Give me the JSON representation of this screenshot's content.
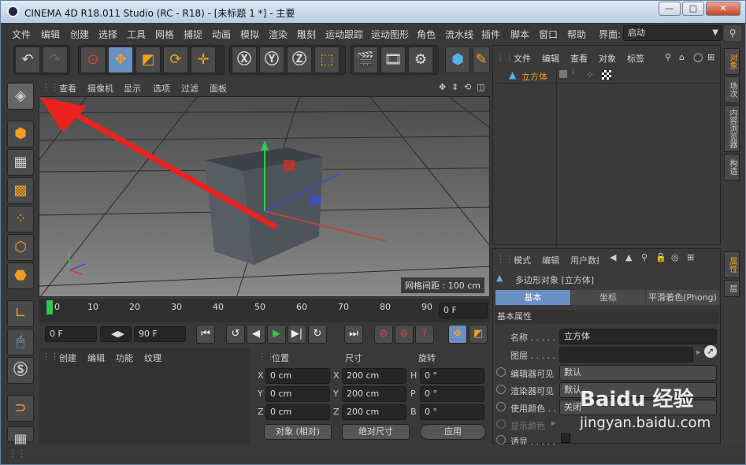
{
  "window": {
    "title": "CINEMA 4D R18.011 Studio (RC - R18) - [未标题 1 *] - 主要",
    "minimize": "—",
    "maximize": "□",
    "close": "✕"
  },
  "menu": [
    "文件",
    "编辑",
    "创建",
    "选择",
    "工具",
    "网格",
    "捕捉",
    "动画",
    "模拟",
    "渲染",
    "雕刻",
    "运动跟踪",
    "运动图形",
    "角色",
    "流水线",
    "插件",
    "脚本",
    "窗口",
    "帮助"
  ],
  "layout": {
    "label": "界面:",
    "value": "启动"
  },
  "viewport": {
    "menus": [
      "查看",
      "摄像机",
      "显示",
      "选项",
      "过滤",
      "面板"
    ],
    "status": "网格间距 : 100 cm"
  },
  "timeline": {
    "ticks": [
      "0",
      "10",
      "20",
      "30",
      "40",
      "50",
      "60",
      "70",
      "80",
      "90"
    ],
    "frame_field": "0 F"
  },
  "playback": {
    "start": "0 F",
    "end": "90 F"
  },
  "material": {
    "menus": [
      "创建",
      "编辑",
      "功能",
      "纹理"
    ]
  },
  "coords": {
    "headers": [
      "位置",
      "尺寸",
      "旋转"
    ],
    "rows": [
      {
        "a": "X",
        "pos": "0 cm",
        "b": "X",
        "size": "200 cm",
        "c": "H",
        "rot": "0 °"
      },
      {
        "a": "Y",
        "pos": "0 cm",
        "b": "Y",
        "size": "200 cm",
        "c": "P",
        "rot": "0 °"
      },
      {
        "a": "Z",
        "pos": "0 cm",
        "b": "Z",
        "size": "200 cm",
        "c": "B",
        "rot": "0 °"
      }
    ],
    "mode": "对象 (相对)",
    "size_mode": "绝对尺寸",
    "apply": "应用"
  },
  "objects": {
    "menus": [
      "文件",
      "编辑",
      "查看",
      "对象",
      "标签"
    ],
    "item": "立方体"
  },
  "attributes": {
    "menus": [
      "模式",
      "编辑",
      "用户数据"
    ],
    "title": "多边形对象 [立方体]",
    "tabs": [
      "基本",
      "坐标",
      "平滑着色(Phong)"
    ],
    "section": "基本属性",
    "fields": [
      {
        "label": "名称 . . . . .",
        "value": "立方体"
      },
      {
        "label": "图层 . . . . .",
        "value": ""
      },
      {
        "label": "编辑器可见",
        "value": "默认"
      },
      {
        "label": "渲染器可见",
        "value": "默认"
      },
      {
        "label": "使用颜色 . .",
        "value": "关闭"
      },
      {
        "label": "显示颜色",
        "value": ""
      },
      {
        "label": "透显 . . . . .",
        "value": ""
      }
    ]
  },
  "right_tabs": [
    "对象",
    "场次",
    "内容浏览器",
    "构造",
    "属性",
    "层"
  ],
  "watermark": {
    "main": "Baidu 经验",
    "sub": "jingyan.baidu.com"
  },
  "colors": {
    "accent": "#6a8fc2",
    "arrow": "#e8231f",
    "green_axis": "#2ec94a",
    "red_axis": "#d63a3a",
    "blue_axis": "#3a4be0"
  }
}
